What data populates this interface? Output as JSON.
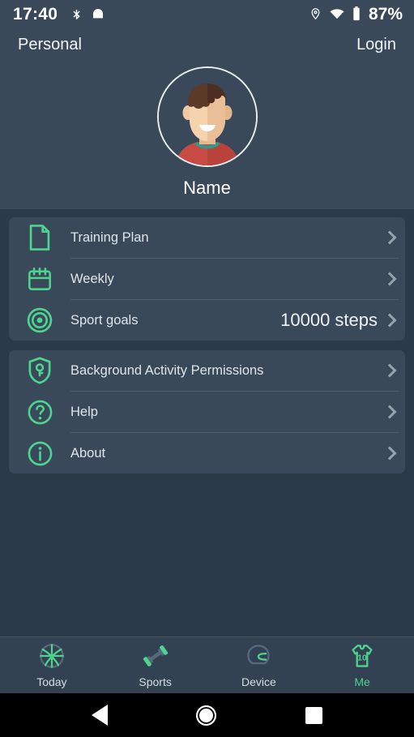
{
  "status_bar": {
    "time": "17:40",
    "battery_percent": "87%",
    "icons": [
      "bluetooth-disconnected-icon",
      "app-bag-icon",
      "location-pin-icon",
      "wifi-off-icon",
      "battery-icon"
    ]
  },
  "app_bar": {
    "title": "Personal",
    "login_label": "Login"
  },
  "profile": {
    "name": "Name",
    "avatar_alt": "user-avatar"
  },
  "cards": [
    {
      "rows": [
        {
          "icon": "document-icon",
          "label": "Training Plan",
          "value": ""
        },
        {
          "icon": "calendar-icon",
          "label": "Weekly",
          "value": ""
        },
        {
          "icon": "target-icon",
          "label": "Sport goals",
          "value": "10000 steps"
        }
      ]
    },
    {
      "rows": [
        {
          "icon": "shield-key-icon",
          "label": "Background Activity Permissions",
          "value": ""
        },
        {
          "icon": "question-circle-icon",
          "label": "Help",
          "value": ""
        },
        {
          "icon": "info-circle-icon",
          "label": "About",
          "value": ""
        }
      ]
    }
  ],
  "bottom_nav": {
    "items": [
      {
        "label": "Today",
        "icon": "basketball-icon",
        "active": false
      },
      {
        "label": "Sports",
        "icon": "dumbbell-icon",
        "active": false
      },
      {
        "label": "Device",
        "icon": "helmet-icon",
        "active": false
      },
      {
        "label": "Me",
        "icon": "jersey-icon",
        "active": true
      }
    ]
  },
  "android_nav": {
    "back": "back-button",
    "home": "home-button",
    "recents": "recents-button"
  },
  "colors": {
    "page_bg": "#2a3a48",
    "header_bg": "#39495a",
    "card_bg": "#39495a",
    "accent_green": "#4ed48f",
    "text_primary": "#eef2f5",
    "text_secondary": "#96a3ae",
    "jersey_number": "10"
  }
}
